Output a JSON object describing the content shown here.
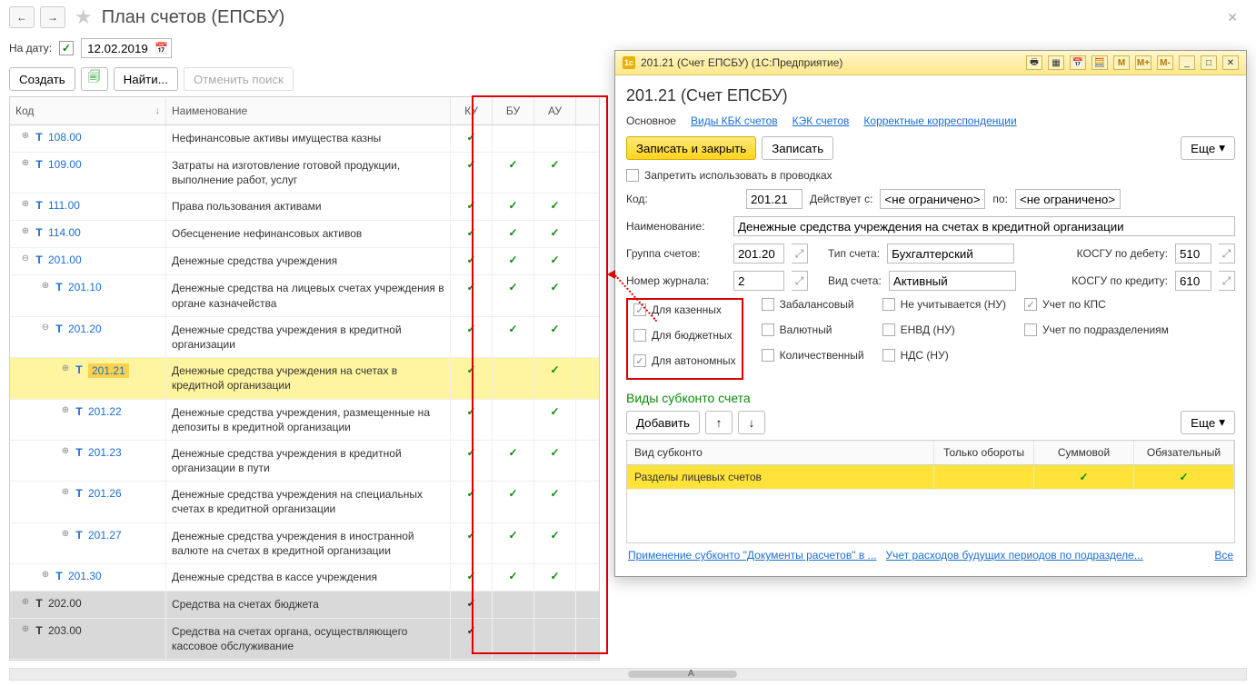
{
  "header": {
    "title": "План счетов (ЕПСБУ)"
  },
  "filter": {
    "date_label": "На дату:",
    "date_value": "12.02.2019"
  },
  "toolbar": {
    "create": "Создать",
    "find": "Найти...",
    "cancel_search": "Отменить поиск"
  },
  "grid": {
    "headers": {
      "code": "Код",
      "name": "Наименование",
      "ku": "КУ",
      "bu": "БУ",
      "au": "АУ"
    },
    "rows": [
      {
        "indent": 1,
        "exp": "+",
        "code": "108.00",
        "name": "Нефинансовые активы имущества казны",
        "ku": true,
        "bu": false,
        "au": false
      },
      {
        "indent": 1,
        "exp": "+",
        "code": "109.00",
        "name": "Затраты на изготовление готовой продукции, выполнение работ, услуг",
        "ku": true,
        "bu": true,
        "au": true
      },
      {
        "indent": 1,
        "exp": "+",
        "code": "111.00",
        "name": "Права пользования активами",
        "ku": true,
        "bu": true,
        "au": true
      },
      {
        "indent": 1,
        "exp": "+",
        "code": "114.00",
        "name": "Обесценение нефинансовых активов",
        "ku": true,
        "bu": true,
        "au": true
      },
      {
        "indent": 1,
        "exp": "−",
        "code": "201.00",
        "name": "Денежные средства учреждения",
        "ku": true,
        "bu": true,
        "au": true
      },
      {
        "indent": 2,
        "exp": "+",
        "code": "201.10",
        "name": "Денежные средства на лицевых счетах учреждения в органе казначейства",
        "ku": true,
        "bu": true,
        "au": true
      },
      {
        "indent": 2,
        "exp": "−",
        "code": "201.20",
        "name": "Денежные средства учреждения в кредитной организации",
        "ku": true,
        "bu": true,
        "au": true
      },
      {
        "indent": 3,
        "exp": "+",
        "code": "201.21",
        "name": "Денежные средства учреждения на счетах в кредитной организации",
        "ku": true,
        "bu": false,
        "au": true,
        "selected": true
      },
      {
        "indent": 3,
        "exp": "+",
        "code": "201.22",
        "name": "Денежные средства учреждения, размещенные на депозиты в кредитной организации",
        "ku": true,
        "bu": false,
        "au": true
      },
      {
        "indent": 3,
        "exp": "+",
        "code": "201.23",
        "name": "Денежные средства учреждения в кредитной организации в пути",
        "ku": true,
        "bu": true,
        "au": true
      },
      {
        "indent": 3,
        "exp": "+",
        "code": "201.26",
        "name": "Денежные средства учреждения на специальных счетах в кредитной организации",
        "ku": true,
        "bu": true,
        "au": true
      },
      {
        "indent": 3,
        "exp": "+",
        "code": "201.27",
        "name": "Денежные средства учреждения в иностранной валюте на счетах в кредитной организации",
        "ku": true,
        "bu": true,
        "au": true
      },
      {
        "indent": 2,
        "exp": "+",
        "code": "201.30",
        "name": "Денежные средства  в кассе учреждения",
        "ku": true,
        "bu": true,
        "au": true
      },
      {
        "indent": 1,
        "exp": "+",
        "code": "202.00",
        "name": "Средства на счетах бюджета",
        "ku": true,
        "bu": false,
        "au": false,
        "gray": true
      },
      {
        "indent": 1,
        "exp": "+",
        "code": "203.00",
        "name": "Средства на счетах органа, осуществляющего кассовое обслуживание",
        "ku": true,
        "bu": false,
        "au": false,
        "gray": true
      }
    ]
  },
  "modal": {
    "wintitle": "201.21 (Счет ЕПСБУ) (1С:Предприятие)",
    "mbtns": {
      "m": "M",
      "mplus": "M+",
      "mminus": "M-"
    },
    "h1": "201.21 (Счет ЕПСБУ)",
    "tabs": [
      "Основное",
      "Виды КБК счетов",
      "КЭК счетов",
      "Корректные корреспонденции"
    ],
    "actions": {
      "save_close": "Записать и закрыть",
      "save": "Записать",
      "more": "Еще"
    },
    "forbid": "Запретить использовать в проводках",
    "fields": {
      "code_label": "Код:",
      "code": "201.21",
      "from_label": "Действует с:",
      "from": "<не ограничено>",
      "to_label": "по:",
      "to": "<не ограничено>",
      "name_label": "Наименование:",
      "name": "Денежные средства учреждения на счетах в кредитной организации",
      "group_label": "Группа счетов:",
      "group": "201.20",
      "acct_type_label": "Тип счета:",
      "acct_type": "Бухгалтерский",
      "kosgu_dt_label": "КОСГУ по дебету:",
      "kosgu_dt": "510",
      "journal_label": "Номер журнала:",
      "journal": "2",
      "acct_kind_label": "Вид счета:",
      "acct_kind": "Активный",
      "kosgu_kt_label": "КОСГУ по кредиту:",
      "kosgu_kt": "610"
    },
    "flags": {
      "treasury": "Для казенных",
      "budget": "Для бюджетных",
      "autonomous": "Для автономных",
      "offbalance": "Забалансовый",
      "currency": "Валютный",
      "quantity": "Количественный",
      "no_tax": "Не учитывается (НУ)",
      "envd": "ЕНВД (НУ)",
      "nds": "НДС (НУ)",
      "kps": "Учет по КПС",
      "dept": "Учет по подразделениям"
    },
    "sub": {
      "title": "Виды субконто счета",
      "add": "Добавить",
      "more": "Еще",
      "headers": {
        "name": "Вид субконто",
        "turn": "Только обороты",
        "sum": "Суммовой",
        "req": "Обязательный"
      },
      "row": {
        "name": "Разделы лицевых счетов",
        "sum": true,
        "req": true
      }
    },
    "links": {
      "l1": "Применение субконто \"Документы расчетов\" в ...",
      "l2": "Учет расходов будущих периодов по подразделе...",
      "all": "Все"
    }
  },
  "scroll_letter": "А"
}
